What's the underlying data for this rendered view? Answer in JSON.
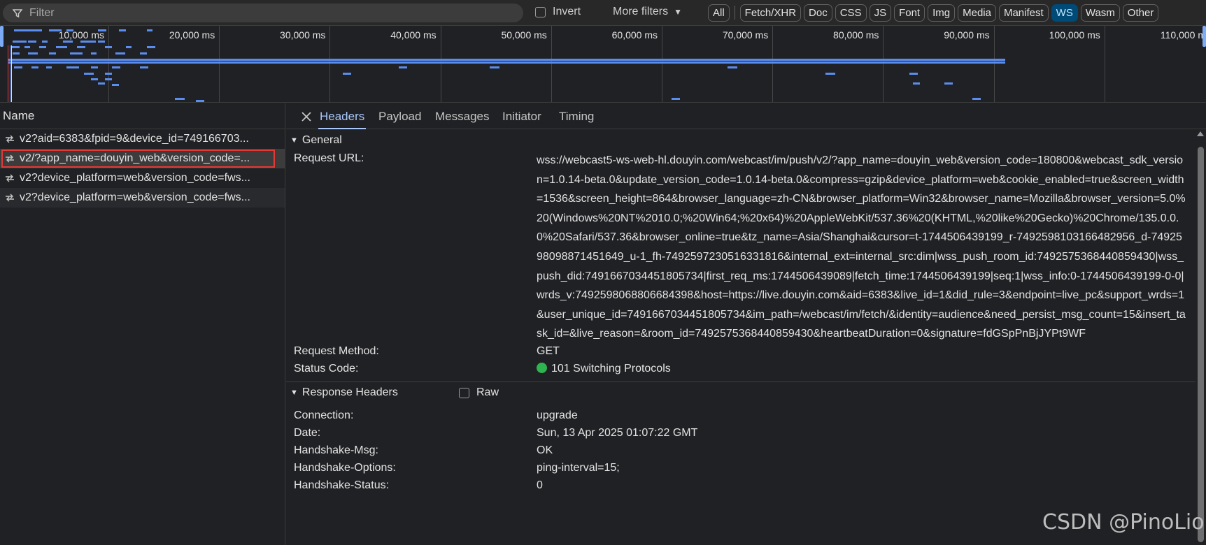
{
  "filterbar": {
    "placeholder": "Filter",
    "invert_label": "Invert",
    "more_filters_label": "More filters",
    "types": [
      "All",
      "Fetch/XHR",
      "Doc",
      "CSS",
      "JS",
      "Font",
      "Img",
      "Media",
      "Manifest",
      "WS",
      "Wasm",
      "Other"
    ],
    "active_type": "WS"
  },
  "overview": {
    "ticks": [
      "10,000 ms",
      "20,000 ms",
      "30,000 ms",
      "40,000 ms",
      "50,000 ms",
      "60,000 ms",
      "70,000 ms",
      "80,000 ms",
      "90,000 ms",
      "100,000 ms",
      "110,000 ms"
    ]
  },
  "requests": {
    "header": "Name",
    "items": [
      "v2?aid=6383&fpid=9&device_id=749166703...",
      "v2/?app_name=douyin_web&version_code=...",
      "v2?device_platform=web&version_code=fws...",
      "v2?device_platform=web&version_code=fws..."
    ],
    "selected_index": 1
  },
  "details": {
    "tabs": [
      "Headers",
      "Payload",
      "Messages",
      "Initiator",
      "Timing"
    ],
    "active_tab": "Headers",
    "general": {
      "title": "General",
      "request_url_label": "Request URL:",
      "request_url": "wss://webcast5-ws-web-hl.douyin.com/webcast/im/push/v2/?app_name=douyin_web&version_code=180800&webcast_sdk_version=1.0.14-beta.0&update_version_code=1.0.14-beta.0&compress=gzip&device_platform=web&cookie_enabled=true&screen_width=1536&screen_height=864&browser_language=zh-CN&browser_platform=Win32&browser_name=Mozilla&browser_version=5.0%20(Windows%20NT%2010.0;%20Win64;%20x64)%20AppleWebKit/537.36%20(KHTML,%20like%20Gecko)%20Chrome/135.0.0.0%20Safari/537.36&browser_online=true&tz_name=Asia/Shanghai&cursor=t-1744506439199_r-7492598103166482956_d-7492598098871451649_u-1_fh-7492597230516331816&internal_ext=internal_src:dim|wss_push_room_id:7492575368440859430|wss_push_did:7491667034451805734|first_req_ms:1744506439089|fetch_time:1744506439199|seq:1|wss_info:0-1744506439199-0-0|wrds_v:7492598068806684398&host=https://live.douyin.com&aid=6383&live_id=1&did_rule=3&endpoint=live_pc&support_wrds=1&user_unique_id=7491667034451805734&im_path=/webcast/im/fetch/&identity=audience&need_persist_msg_count=15&insert_task_id=&live_reason=&room_id=7492575368440859430&heartbeatDuration=0&signature=fdGSpPnBjJYPt9WF",
      "method_label": "Request Method:",
      "method": "GET",
      "status_label": "Status Code:",
      "status": "101 Switching Protocols"
    },
    "response_headers": {
      "title": "Response Headers",
      "raw_label": "Raw",
      "items": [
        {
          "name": "Connection:",
          "value": "upgrade"
        },
        {
          "name": "Date:",
          "value": "Sun, 13 Apr 2025 01:07:22 GMT"
        },
        {
          "name": "Handshake-Msg:",
          "value": "OK"
        },
        {
          "name": "Handshake-Options:",
          "value": "ping-interval=15;"
        },
        {
          "name": "Handshake-Status:",
          "value": "0"
        }
      ]
    }
  },
  "watermark": "CSDN @PinoLio",
  "colors": {
    "accent": "#a8c7fa",
    "status_ok": "#2fb550",
    "selection_outline": "#e53935",
    "timeline_bar": "#5b8def"
  }
}
